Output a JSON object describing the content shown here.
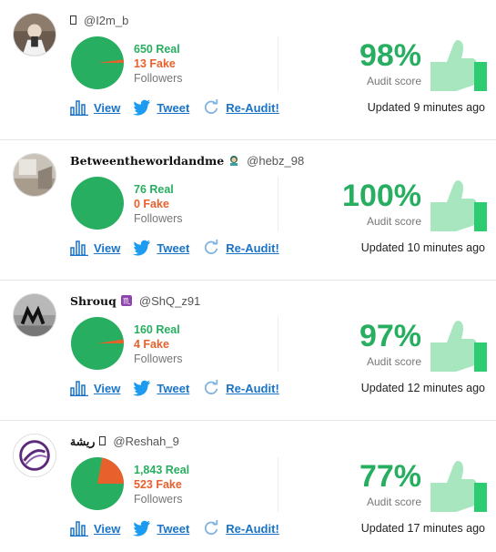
{
  "cards": [
    {
      "display_name": "",
      "handle": "@I2m_b",
      "real": "650 Real",
      "fake": "13 Fake",
      "fake_fraction": 0.0196,
      "followers_label": "Followers",
      "score": "98%",
      "score_label": "Audit score",
      "updated": "Updated 9 minutes ago"
    },
    {
      "display_name": "Betweentheworldandme",
      "handle": "@hebz_98",
      "real": "76 Real",
      "fake": "0 Fake",
      "fake_fraction": 0.0,
      "followers_label": "Followers",
      "score": "100%",
      "score_label": "Audit score",
      "updated": "Updated 10 minutes ago"
    },
    {
      "display_name": "Shrouq",
      "handle": "@ShQ_z91",
      "real": "160 Real",
      "fake": "4 Fake",
      "fake_fraction": 0.0244,
      "followers_label": "Followers",
      "score": "97%",
      "score_label": "Audit score",
      "updated": "Updated 12 minutes ago"
    },
    {
      "display_name": "ريشة",
      "handle": "@Reshah_9",
      "real": "1,843 Real",
      "fake": "523 Fake",
      "fake_fraction": 0.221,
      "followers_label": "Followers",
      "score": "77%",
      "score_label": "Audit score",
      "updated": "Updated 17 minutes ago"
    }
  ],
  "actions": {
    "view": "View",
    "tweet": "Tweet",
    "reaudit": "Re-Audit!"
  },
  "colors": {
    "real": "#27ae60",
    "fake": "#e8612c",
    "link": "#1a73c7",
    "thumb": "#a8e6c0",
    "thumb_cuff": "#2ecc71"
  },
  "icons": {
    "view": "bar-chart-icon",
    "tweet": "twitter-bird-icon",
    "reaudit": "refresh-icon",
    "score": "thumbs-up-icon"
  }
}
